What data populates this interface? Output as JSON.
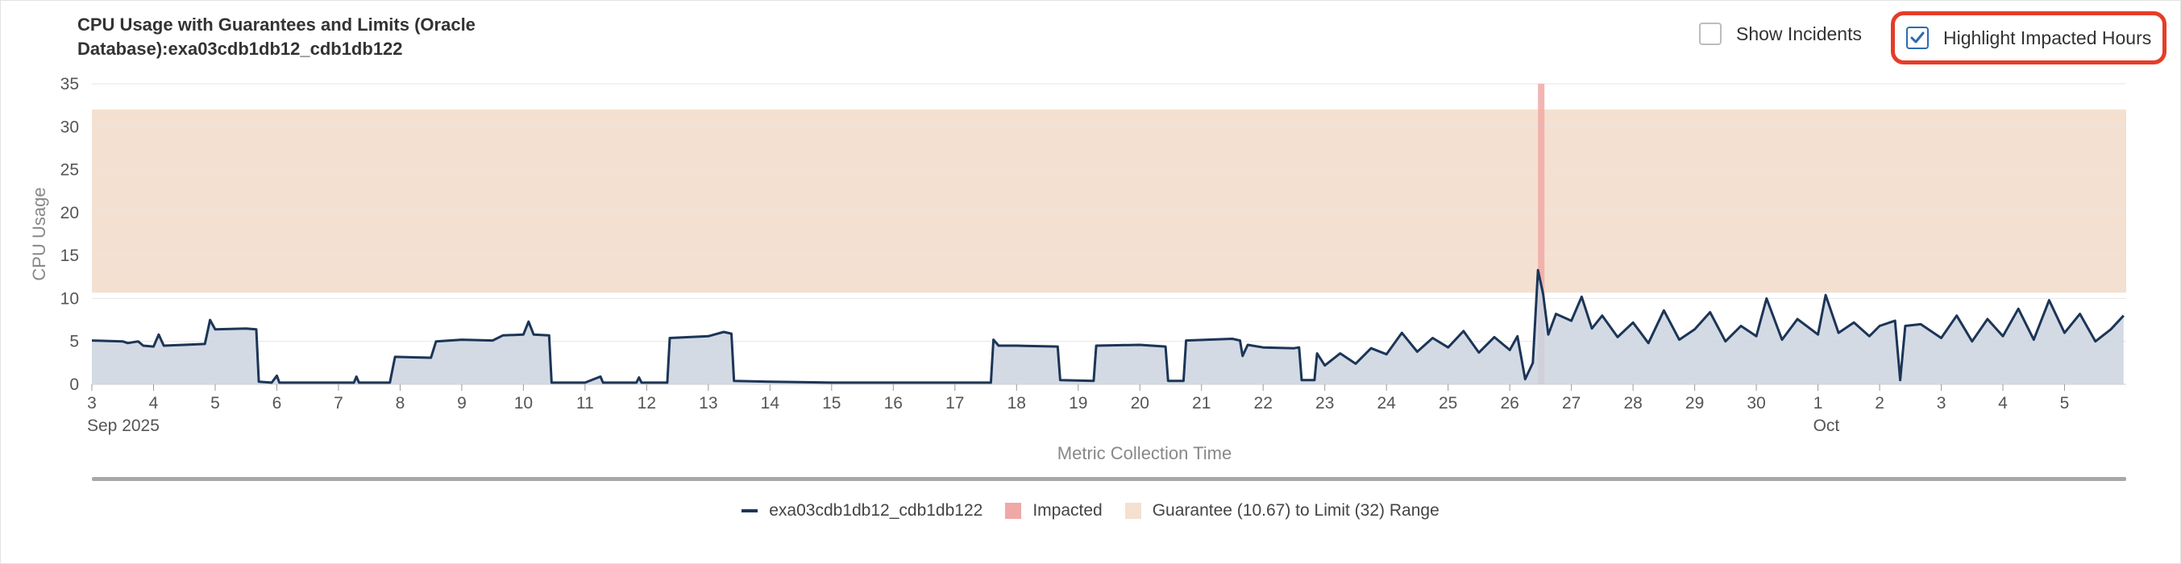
{
  "chart_header": {
    "title_line1": "CPU Usage with Guarantees and Limits (Oracle",
    "title_line2": "Database):exa03cdb1db12_cdb1db122"
  },
  "controls": {
    "show_incidents": {
      "label": "Show Incidents",
      "checked": false
    },
    "highlight_impacted": {
      "label": "Highlight Impacted Hours",
      "checked": true
    }
  },
  "colors": {
    "series": "#1c3557",
    "series_fill": "#cbd3df",
    "impacted": "#f0a8a6",
    "range_band": "#f4e0d0",
    "callout": "#e53c28"
  },
  "chart_data": {
    "type": "area",
    "ylabel": "CPU Usage",
    "xlabel": "Metric Collection Time",
    "ylim": [
      0,
      35
    ],
    "yticks": [
      0,
      5,
      10,
      15,
      20,
      25,
      30,
      35
    ],
    "grid": true,
    "legend_position": "bottom",
    "x_range_days": [
      "2025-09-03",
      "2025-10-06"
    ],
    "x_ticks": [
      {
        "day": "2025-09-03",
        "label": "3",
        "sublabel": "Sep 2025"
      },
      {
        "day": "2025-09-04",
        "label": "4"
      },
      {
        "day": "2025-09-05",
        "label": "5"
      },
      {
        "day": "2025-09-06",
        "label": "6"
      },
      {
        "day": "2025-09-07",
        "label": "7"
      },
      {
        "day": "2025-09-08",
        "label": "8"
      },
      {
        "day": "2025-09-09",
        "label": "9"
      },
      {
        "day": "2025-09-10",
        "label": "10"
      },
      {
        "day": "2025-09-11",
        "label": "11"
      },
      {
        "day": "2025-09-12",
        "label": "12"
      },
      {
        "day": "2025-09-13",
        "label": "13"
      },
      {
        "day": "2025-09-14",
        "label": "14"
      },
      {
        "day": "2025-09-15",
        "label": "15"
      },
      {
        "day": "2025-09-16",
        "label": "16"
      },
      {
        "day": "2025-09-17",
        "label": "17"
      },
      {
        "day": "2025-09-18",
        "label": "18"
      },
      {
        "day": "2025-09-19",
        "label": "19"
      },
      {
        "day": "2025-09-20",
        "label": "20"
      },
      {
        "day": "2025-09-21",
        "label": "21"
      },
      {
        "day": "2025-09-22",
        "label": "22"
      },
      {
        "day": "2025-09-23",
        "label": "23"
      },
      {
        "day": "2025-09-24",
        "label": "24"
      },
      {
        "day": "2025-09-25",
        "label": "25"
      },
      {
        "day": "2025-09-26",
        "label": "26"
      },
      {
        "day": "2025-09-27",
        "label": "27"
      },
      {
        "day": "2025-09-28",
        "label": "28"
      },
      {
        "day": "2025-09-29",
        "label": "29"
      },
      {
        "day": "2025-09-30",
        "label": "30"
      },
      {
        "day": "2025-10-01",
        "label": "1",
        "sublabel": "Oct"
      },
      {
        "day": "2025-10-02",
        "label": "2"
      },
      {
        "day": "2025-10-03",
        "label": "3"
      },
      {
        "day": "2025-10-04",
        "label": "4"
      },
      {
        "day": "2025-10-05",
        "label": "5"
      }
    ],
    "range_band": {
      "from": 10.67,
      "to": 32
    },
    "impacted_period": {
      "from": "2025-09-26 11:00",
      "to": "2025-09-26 13:00"
    },
    "series": [
      {
        "name": "exa03cdb1db12_cdb1db122",
        "points": [
          [
            "2025-09-03 00:00",
            5.1
          ],
          [
            "2025-09-03 12:00",
            5.0
          ],
          [
            "2025-09-03 14:00",
            4.8
          ],
          [
            "2025-09-03 18:00",
            5.0
          ],
          [
            "2025-09-03 20:00",
            4.5
          ],
          [
            "2025-09-04 00:00",
            4.4
          ],
          [
            "2025-09-04 02:00",
            5.8
          ],
          [
            "2025-09-04 04:00",
            4.5
          ],
          [
            "2025-09-04 12:00",
            4.6
          ],
          [
            "2025-09-04 20:00",
            4.7
          ],
          [
            "2025-09-04 22:00",
            7.5
          ],
          [
            "2025-09-05 00:00",
            6.4
          ],
          [
            "2025-09-05 12:00",
            6.5
          ],
          [
            "2025-09-05 16:00",
            6.4
          ],
          [
            "2025-09-05 17:00",
            0.3
          ],
          [
            "2025-09-05 22:00",
            0.2
          ],
          [
            "2025-09-06 00:00",
            1.0
          ],
          [
            "2025-09-06 01:00",
            0.2
          ],
          [
            "2025-09-07 00:00",
            0.2
          ],
          [
            "2025-09-07 06:00",
            0.2
          ],
          [
            "2025-09-07 07:00",
            0.9
          ],
          [
            "2025-09-07 08:00",
            0.2
          ],
          [
            "2025-09-07 20:00",
            0.2
          ],
          [
            "2025-09-07 22:00",
            3.2
          ],
          [
            "2025-09-08 12:00",
            3.1
          ],
          [
            "2025-09-08 14:00",
            5.0
          ],
          [
            "2025-09-09 00:00",
            5.2
          ],
          [
            "2025-09-09 12:00",
            5.1
          ],
          [
            "2025-09-09 16:00",
            5.7
          ],
          [
            "2025-09-10 00:00",
            5.8
          ],
          [
            "2025-09-10 02:00",
            7.3
          ],
          [
            "2025-09-10 04:00",
            5.8
          ],
          [
            "2025-09-10 10:00",
            5.7
          ],
          [
            "2025-09-10 11:00",
            0.2
          ],
          [
            "2025-09-11 00:00",
            0.2
          ],
          [
            "2025-09-11 06:00",
            0.9
          ],
          [
            "2025-09-11 07:00",
            0.2
          ],
          [
            "2025-09-11 20:00",
            0.2
          ],
          [
            "2025-09-11 21:00",
            0.8
          ],
          [
            "2025-09-11 22:00",
            0.2
          ],
          [
            "2025-09-12 08:00",
            0.2
          ],
          [
            "2025-09-12 09:00",
            5.4
          ],
          [
            "2025-09-13 00:00",
            5.6
          ],
          [
            "2025-09-13 06:00",
            6.1
          ],
          [
            "2025-09-13 09:00",
            5.9
          ],
          [
            "2025-09-13 10:00",
            0.4
          ],
          [
            "2025-09-14 00:00",
            0.3
          ],
          [
            "2025-09-15 00:00",
            0.2
          ],
          [
            "2025-09-16 00:00",
            0.2
          ],
          [
            "2025-09-17 00:00",
            0.2
          ],
          [
            "2025-09-17 14:00",
            0.2
          ],
          [
            "2025-09-17 15:00",
            5.2
          ],
          [
            "2025-09-17 17:00",
            4.5
          ],
          [
            "2025-09-18 00:00",
            4.5
          ],
          [
            "2025-09-18 16:00",
            4.4
          ],
          [
            "2025-09-18 17:00",
            0.5
          ],
          [
            "2025-09-19 06:00",
            0.4
          ],
          [
            "2025-09-19 07:00",
            4.5
          ],
          [
            "2025-09-20 00:00",
            4.6
          ],
          [
            "2025-09-20 10:00",
            4.4
          ],
          [
            "2025-09-20 11:00",
            0.4
          ],
          [
            "2025-09-20 17:00",
            0.4
          ],
          [
            "2025-09-20 18:00",
            5.1
          ],
          [
            "2025-09-21 12:00",
            5.3
          ],
          [
            "2025-09-21 15:00",
            5.1
          ],
          [
            "2025-09-21 16:00",
            3.3
          ],
          [
            "2025-09-21 18:00",
            4.6
          ],
          [
            "2025-09-22 00:00",
            4.3
          ],
          [
            "2025-09-22 12:00",
            4.2
          ],
          [
            "2025-09-22 14:00",
            4.3
          ],
          [
            "2025-09-22 15:00",
            0.5
          ],
          [
            "2025-09-22 20:00",
            0.5
          ],
          [
            "2025-09-22 21:00",
            3.6
          ],
          [
            "2025-09-23 00:00",
            2.2
          ],
          [
            "2025-09-23 06:00",
            3.6
          ],
          [
            "2025-09-23 12:00",
            2.4
          ],
          [
            "2025-09-23 18:00",
            4.2
          ],
          [
            "2025-09-24 00:00",
            3.5
          ],
          [
            "2025-09-24 06:00",
            6.0
          ],
          [
            "2025-09-24 12:00",
            3.8
          ],
          [
            "2025-09-24 18:00",
            5.4
          ],
          [
            "2025-09-25 00:00",
            4.3
          ],
          [
            "2025-09-25 06:00",
            6.2
          ],
          [
            "2025-09-25 12:00",
            3.7
          ],
          [
            "2025-09-25 18:00",
            5.5
          ],
          [
            "2025-09-26 00:00",
            4.0
          ],
          [
            "2025-09-26 03:00",
            5.6
          ],
          [
            "2025-09-26 06:00",
            0.6
          ],
          [
            "2025-09-26 09:00",
            2.5
          ],
          [
            "2025-09-26 11:00",
            13.3
          ],
          [
            "2025-09-26 13:00",
            10.5
          ],
          [
            "2025-09-26 15:00",
            5.8
          ],
          [
            "2025-09-26 18:00",
            8.2
          ],
          [
            "2025-09-27 00:00",
            7.4
          ],
          [
            "2025-09-27 04:00",
            10.2
          ],
          [
            "2025-09-27 08:00",
            6.5
          ],
          [
            "2025-09-27 12:00",
            8.0
          ],
          [
            "2025-09-27 18:00",
            5.5
          ],
          [
            "2025-09-28 00:00",
            7.2
          ],
          [
            "2025-09-28 06:00",
            4.8
          ],
          [
            "2025-09-28 12:00",
            8.6
          ],
          [
            "2025-09-28 18:00",
            5.2
          ],
          [
            "2025-09-29 00:00",
            6.4
          ],
          [
            "2025-09-29 06:00",
            8.4
          ],
          [
            "2025-09-29 12:00",
            5.0
          ],
          [
            "2025-09-29 18:00",
            6.8
          ],
          [
            "2025-09-30 00:00",
            5.6
          ],
          [
            "2025-09-30 04:00",
            10.0
          ],
          [
            "2025-09-30 10:00",
            5.2
          ],
          [
            "2025-09-30 16:00",
            7.6
          ],
          [
            "2025-10-01 00:00",
            5.8
          ],
          [
            "2025-10-01 03:00",
            10.4
          ],
          [
            "2025-10-01 08:00",
            6.0
          ],
          [
            "2025-10-01 14:00",
            7.2
          ],
          [
            "2025-10-01 20:00",
            5.6
          ],
          [
            "2025-10-02 00:00",
            6.8
          ],
          [
            "2025-10-02 06:00",
            7.4
          ],
          [
            "2025-10-02 08:00",
            0.5
          ],
          [
            "2025-10-02 10:00",
            6.8
          ],
          [
            "2025-10-02 16:00",
            7.0
          ],
          [
            "2025-10-03 00:00",
            5.4
          ],
          [
            "2025-10-03 06:00",
            8.0
          ],
          [
            "2025-10-03 12:00",
            5.0
          ],
          [
            "2025-10-03 18:00",
            7.6
          ],
          [
            "2025-10-04 00:00",
            5.6
          ],
          [
            "2025-10-04 06:00",
            8.8
          ],
          [
            "2025-10-04 12:00",
            5.2
          ],
          [
            "2025-10-04 18:00",
            9.8
          ],
          [
            "2025-10-05 00:00",
            6.0
          ],
          [
            "2025-10-05 06:00",
            8.2
          ],
          [
            "2025-10-05 12:00",
            5.0
          ],
          [
            "2025-10-05 18:00",
            6.4
          ],
          [
            "2025-10-05 23:00",
            8.0
          ]
        ]
      }
    ]
  },
  "legend": {
    "series_label": "exa03cdb1db12_cdb1db122",
    "impacted_label": "Impacted",
    "range_label": "Guarantee (10.67) to Limit (32) Range"
  }
}
